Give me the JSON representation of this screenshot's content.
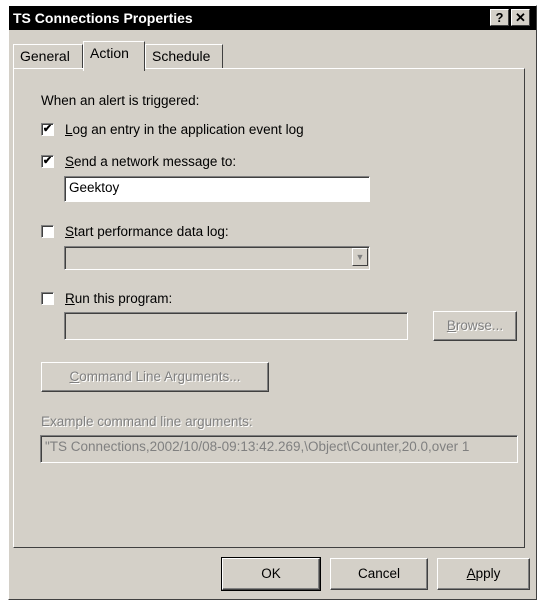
{
  "window": {
    "title": "TS Connections Properties",
    "help_glyph": "?",
    "close_glyph": "✕"
  },
  "tabs": [
    {
      "label": "General",
      "selected": false
    },
    {
      "label": "Action",
      "selected": true
    },
    {
      "label": "Schedule",
      "selected": false
    }
  ],
  "action": {
    "intro": "When an alert is triggered:",
    "log_entry": {
      "mnemonic": "L",
      "rest": "og an entry in the application event log",
      "checked": true
    },
    "send_message": {
      "mnemonic": "S",
      "rest": "end a network message to:",
      "checked": true,
      "value": "Geektoy"
    },
    "start_log": {
      "mnemonic": "S",
      "rest": "tart performance data log:",
      "checked": false,
      "value": ""
    },
    "run_program": {
      "mnemonic": "R",
      "rest": "un this program:",
      "checked": false,
      "value": ""
    },
    "browse": {
      "mnemonic": "B",
      "rest": "rowse..."
    },
    "cmd_args": {
      "mnemonic": "C",
      "rest": "ommand Line Arguments..."
    },
    "example_label": "Example command line arguments:",
    "example_value": "\"TS Connections,2002/10/08-09:13:42.269,\\Object\\Counter,20.0,over 1"
  },
  "footer": {
    "ok": "OK",
    "cancel": "Cancel",
    "apply": {
      "mnemonic": "A",
      "rest": "pply"
    }
  },
  "check_glyph": "✔",
  "dropdown_glyph": "▼"
}
